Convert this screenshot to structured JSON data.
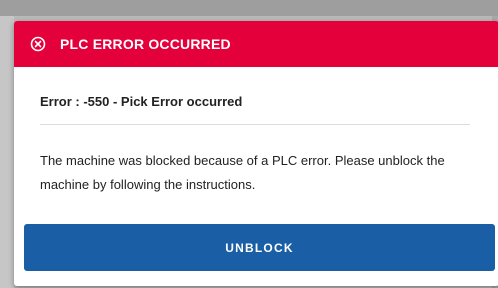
{
  "dialog": {
    "title": "PLC ERROR OCCURRED",
    "header_icon": "circle-x-icon",
    "header_color": "#e4003b",
    "error_line": "Error : -550 - Pick Error occurred",
    "message": "The machine was blocked because of a PLC error. Please unblock the machine by following the instructions.",
    "button_label": "UNBLOCK",
    "button_color": "#1a5fa6"
  }
}
